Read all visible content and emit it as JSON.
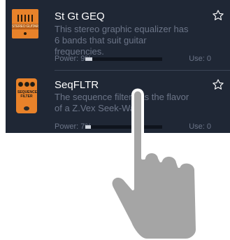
{
  "effects": [
    {
      "name": "St Gt GEQ",
      "description": "This stereo graphic equalizer has 6 bands that suit guitar frequencies.",
      "power_label": "Power: 9%",
      "power_fraction": 0.09,
      "use_label": "Use: 0",
      "thumbnail_text": "STEREO GUITAR GEQ",
      "thumbnail_icon": "stereo-guitar-geq-pedal-icon"
    },
    {
      "name": "SeqFLTR",
      "description": "The sequence filter has the flavor of a Z.Vex Seek-Wah.",
      "power_label": "Power: 7%",
      "power_fraction": 0.07,
      "use_label": "Use: 0",
      "thumbnail_text_1": "SEQUENCE",
      "thumbnail_text_2": "FILTER",
      "thumbnail_icon": "sequence-filter-pedal-icon"
    }
  ],
  "icons": {
    "favorite": "star-outline-icon",
    "gesture": "tap-hand-icon"
  },
  "colors": {
    "panel_bg": "#1f2735",
    "title": "#ffffff",
    "muted_text": "#6c7588",
    "bar_track": "#0f141d",
    "bar_fill": "#cfd4dd",
    "pedal_orange": "#e8822a",
    "hand": "#a5a5a5"
  }
}
